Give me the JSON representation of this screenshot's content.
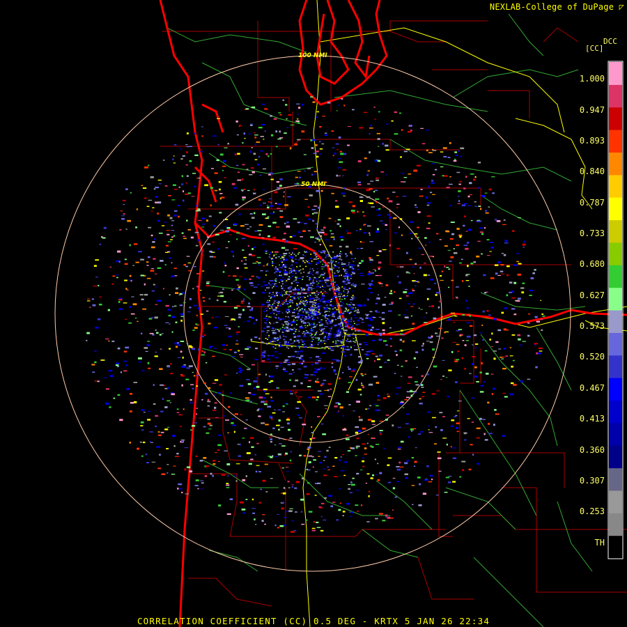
{
  "header": {
    "credit": "NEXLAB-College of DuPage"
  },
  "legend": {
    "product_code": "DCC",
    "units": "[CC]",
    "ticks": [
      "1.000",
      "0.947",
      "0.893",
      "0.840",
      "0.787",
      "0.733",
      "0.680",
      "0.627",
      "0.573",
      "0.520",
      "0.467",
      "0.413",
      "0.360",
      "0.307",
      "0.253",
      "TH"
    ],
    "colors": [
      "#ff99cc",
      "#dd3366",
      "#cc0000",
      "#ff3300",
      "#ff8800",
      "#ffcc00",
      "#ffff00",
      "#cccc00",
      "#88cc00",
      "#33cc33",
      "#88ff88",
      "#9999cc",
      "#6666dd",
      "#3333cc",
      "#0000ff",
      "#0000cc",
      "#0000aa",
      "#000088",
      "#666688",
      "#999999",
      "#888888",
      "#000000"
    ]
  },
  "map": {
    "rings": [
      "100 NMI",
      "50 NMI"
    ],
    "colors": {
      "state_border": "#ff0000",
      "county_border": "#aa0000",
      "highway": "#ffff00",
      "river": "#33aa33",
      "range_ring": "#ffccaa"
    }
  },
  "footer": {
    "caption": "CORRELATION COEFFICIENT (CC) 0.5 DEG - KRTX 5 JAN 26 22:34"
  }
}
